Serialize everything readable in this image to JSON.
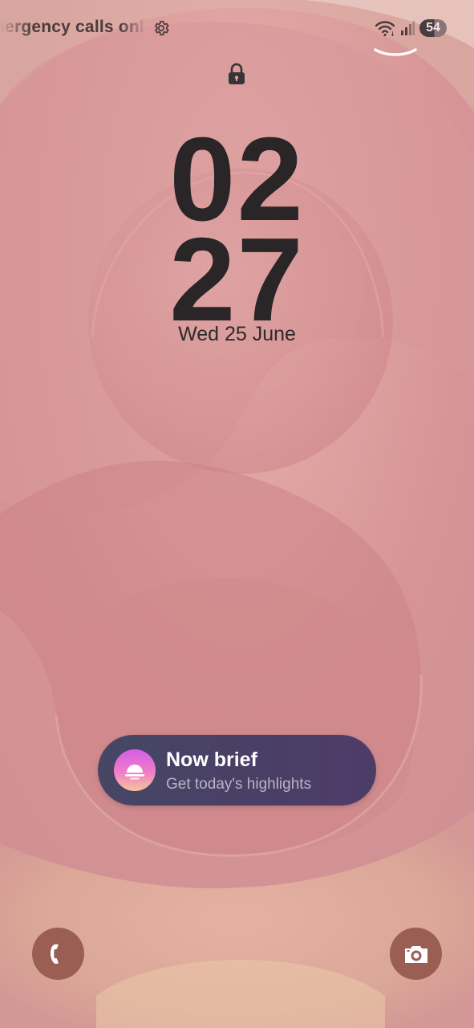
{
  "status_bar": {
    "notification_ticker": "Emergency calls only",
    "battery_level": "54",
    "icons": [
      "settings-icon",
      "wifi-icon",
      "signal-icon",
      "battery-icon"
    ]
  },
  "lock_screen": {
    "lock_icon": "lock-icon",
    "clock": {
      "hours": "02",
      "minutes": "27"
    },
    "date": "Wed 25 June"
  },
  "now_brief": {
    "title": "Now brief",
    "subtitle": "Get today's highlights",
    "icon": "sunrise-icon"
  },
  "shortcuts": {
    "left": "phone-icon",
    "right": "camera-icon"
  },
  "colors": {
    "wallpaper_base": "#d89a9b",
    "clock_text": "#2a2627",
    "pill_background": "#474466",
    "shortcut_background": "#9a5e52"
  }
}
